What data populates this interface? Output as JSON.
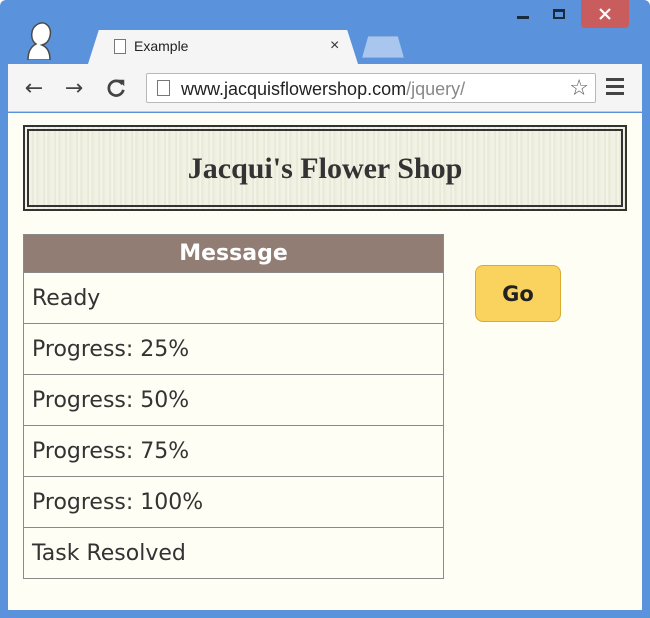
{
  "window": {
    "controls": {
      "minimize": "minimize-icon",
      "maximize": "maximize-icon",
      "close": "close-icon"
    }
  },
  "tab": {
    "title": "Example",
    "close_label": "×"
  },
  "toolbar": {
    "back_glyph": "←",
    "forward_glyph": "→",
    "reload_glyph": "C",
    "url_host": "www.jacquisflowershop.com",
    "url_path": "/jquery/",
    "star_glyph": "☆"
  },
  "page": {
    "shop_title": "Jacqui's Flower Shop",
    "table": {
      "header": "Message",
      "rows": [
        "Ready",
        "Progress: 25%",
        "Progress: 50%",
        "Progress: 75%",
        "Progress: 100%",
        "Task Resolved"
      ]
    },
    "go_button": "Go"
  },
  "colors": {
    "frame": "#5a93dc",
    "close": "#c95c5c",
    "table_header": "#917d73",
    "button": "#fad25e",
    "page_background": "#fffef5"
  }
}
